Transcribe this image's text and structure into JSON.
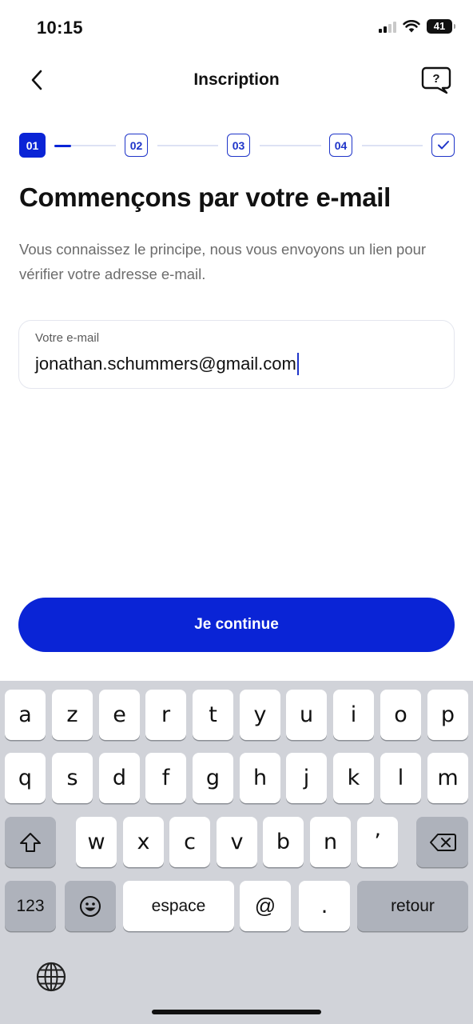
{
  "status_bar": {
    "time": "10:15",
    "battery": "41"
  },
  "header": {
    "title": "Inscription",
    "help_glyph": "?"
  },
  "stepper": {
    "steps": [
      "01",
      "02",
      "03",
      "04"
    ],
    "active_step": 1,
    "final_icon": "check-icon"
  },
  "content": {
    "headline": "Commençons par votre e-mail",
    "description": "Vous connaissez le principe, nous vous envoyons un lien pour vérifier votre adresse e-mail."
  },
  "email_field": {
    "label": "Votre e-mail",
    "value": "jonathan.schummers@gmail.com"
  },
  "cta": {
    "label": "Je continue"
  },
  "keyboard": {
    "row1": [
      "a",
      "z",
      "e",
      "r",
      "t",
      "y",
      "u",
      "i",
      "o",
      "p"
    ],
    "row2": [
      "q",
      "s",
      "d",
      "f",
      "g",
      "h",
      "j",
      "k",
      "l",
      "m"
    ],
    "row3": [
      "w",
      "x",
      "c",
      "v",
      "b",
      "n",
      "’"
    ],
    "numbers_label": "123",
    "space_label": "espace",
    "at_label": "@",
    "dot_label": ".",
    "return_label": "retour"
  },
  "colors": {
    "accent": "#0a24d6",
    "stepper_outline": "#1f35c9",
    "keyboard_bg": "#d1d3d9"
  }
}
